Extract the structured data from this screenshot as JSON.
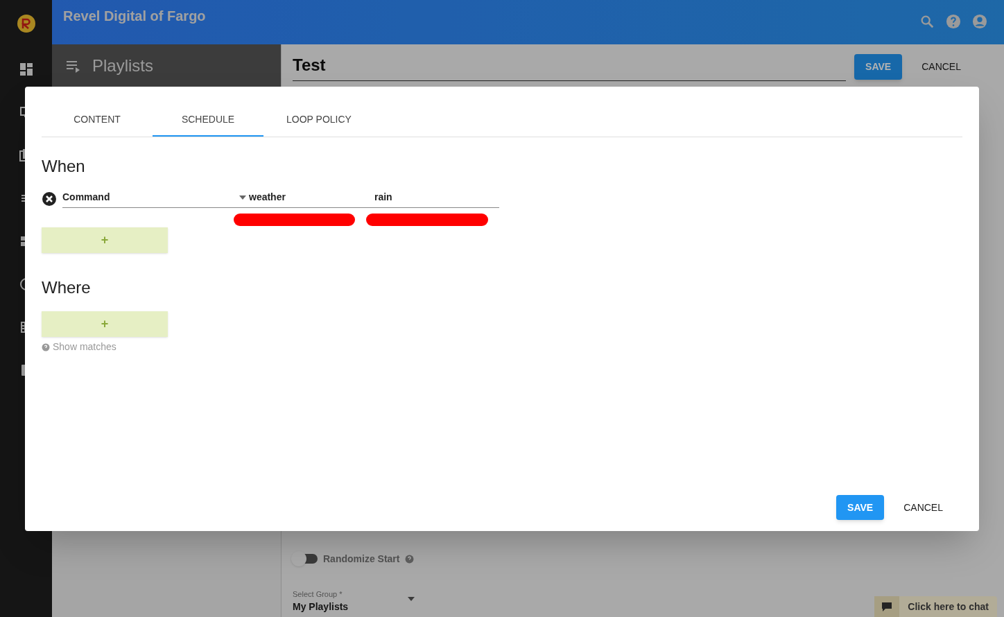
{
  "header": {
    "title": "Revel Digital of Fargo"
  },
  "nav": {
    "items": [
      {
        "kind": "dashboard"
      },
      {
        "kind": "monitor"
      },
      {
        "kind": "media"
      },
      {
        "kind": "list"
      },
      {
        "kind": "layout"
      },
      {
        "kind": "clock"
      },
      {
        "kind": "grid"
      },
      {
        "kind": "device"
      }
    ]
  },
  "panel": {
    "title": "Playlists"
  },
  "editor": {
    "title": "Test",
    "buttons": [
      {
        "label": "SAVE",
        "kind": "primary"
      },
      {
        "label": "CANCEL",
        "kind": "flat"
      }
    ],
    "randomize": {
      "label": "Randomize Start",
      "on": false
    },
    "select_group": {
      "label": "Select Group *",
      "value": "My Playlists"
    }
  },
  "chat": {
    "label": "Click here to chat"
  },
  "dialog": {
    "tabs": [
      {
        "label": "CONTENT",
        "selected": false
      },
      {
        "label": "SCHEDULE",
        "selected": true
      },
      {
        "label": "LOOP POLICY",
        "selected": false
      }
    ],
    "when": {
      "heading": "When",
      "conditions": [
        {
          "field": "Command",
          "operator": "weather",
          "value": "rain",
          "invalid": true
        }
      ],
      "add": "+"
    },
    "where": {
      "heading": "Where",
      "add": "+",
      "link": "Show matches"
    },
    "buttons": [
      {
        "label": "SAVE",
        "kind": "primary"
      },
      {
        "label": "CANCEL",
        "kind": "flat"
      }
    ]
  }
}
